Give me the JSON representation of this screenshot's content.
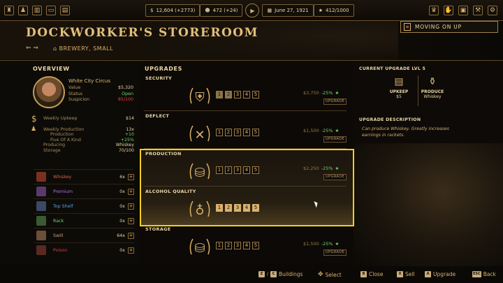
{
  "topbar": {
    "money": "12,604 (+2773)",
    "people": "472 (+24)",
    "date": "June 27, 1921",
    "rank": "412/1000"
  },
  "header": {
    "title": "DOCKWORKER'S STOREROOM",
    "subtitle": "BREWERY, SMALL",
    "moving_on_up": "MOVING ON UP"
  },
  "overview": {
    "heading": "OVERVIEW",
    "name": "White City Circus",
    "value_label": "Value",
    "value": "$5,320",
    "status_label": "Status",
    "status": "Open",
    "suspicion_label": "Suspicion",
    "suspicion": "85/100",
    "weekly_upkeep_label": "Weekly Upkeep",
    "weekly_upkeep": "$14",
    "weekly_production_label": "Weekly Production",
    "weekly_production": "13x",
    "production_label": "Production",
    "production": "+10",
    "five_of_a_kind_label": "Five Of A Kind",
    "five_of_a_kind": "+25%",
    "producing_label": "Producing",
    "producing": "Whiskey",
    "storage_label": "Storage",
    "storage": "70/100",
    "items": [
      {
        "name": "Whiskey",
        "count": "6x",
        "color": "#e0604a"
      },
      {
        "name": "Premium",
        "count": "0x",
        "color": "#b070e0"
      },
      {
        "name": "Top Shelf",
        "count": "0x",
        "color": "#5aa0e8"
      },
      {
        "name": "Rack",
        "count": "0x",
        "color": "#6fd36f"
      },
      {
        "name": "Swill",
        "count": "64x",
        "color": "#c8a878"
      },
      {
        "name": "Poison",
        "count": "0x",
        "color": "#e03a3a"
      }
    ]
  },
  "upgrades": {
    "heading": "UPGRADES",
    "rows": [
      {
        "label": "SECURITY",
        "price": "$3,750",
        "pct": "-25%",
        "button": "UPGRADE",
        "level": 2,
        "emblem": "shield-icon"
      },
      {
        "label": "DEFLECT",
        "price": "$1,500",
        "pct": "-25%",
        "button": "UPGRADE",
        "level": 0,
        "emblem": "crossed-rifles-icon"
      },
      {
        "label": "PRODUCTION",
        "price": "$2,250",
        "pct": "-25%",
        "button": "UPGRADE",
        "level": 0,
        "emblem": "barrel-arrow-icon"
      },
      {
        "label": "ALCOHOL QUALITY",
        "price": "",
        "pct": "",
        "button": "",
        "level": 5,
        "emblem": "bottle-laurel-icon"
      },
      {
        "label": "STORAGE",
        "price": "$1,500",
        "pct": "-25%",
        "button": "UPGRADE",
        "level": 0,
        "emblem": "barrels-icon"
      }
    ],
    "levels": [
      "1",
      "2",
      "3",
      "4",
      "5"
    ]
  },
  "current_upgrade": {
    "heading": "CURRENT UPGRADE LVL 5",
    "upkeep_label": "UPKEEP",
    "upkeep_value": "$5",
    "produce_label": "PRODUCE",
    "produce_value": "Whiskey",
    "desc_heading": "UPGRADE DESCRIPTION",
    "desc_text": "Can produce Whiskey. Greatly increases earnings in rackets."
  },
  "hints": {
    "buildings_keys": [
      "Z",
      "C"
    ],
    "buildings": "Buildings",
    "select": "Select",
    "close_key": "B",
    "close": "Close",
    "sell_key": "X",
    "sell": "Sell",
    "upgrade_key": "A",
    "upgrade": "Upgrade",
    "back_key": "ESC",
    "back": "Back"
  },
  "colors": {
    "gold": "#d9b16c",
    "highlight": "#f4cf1c",
    "green": "#6fd36f",
    "red": "#e44040"
  }
}
